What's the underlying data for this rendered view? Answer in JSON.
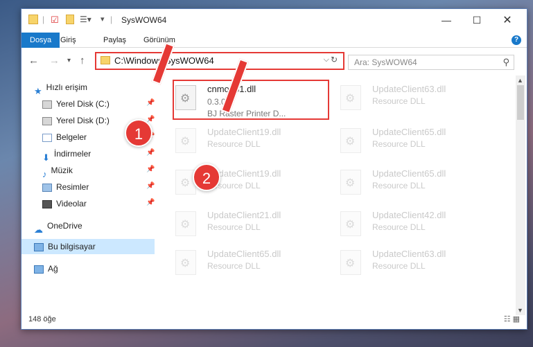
{
  "window": {
    "title": "SysWOW64"
  },
  "ribbon": {
    "tabs": [
      "Dosya",
      "Giriş",
      "Paylaş",
      "Görünüm"
    ]
  },
  "address": {
    "path": "C:\\Windows\\SysWOW64"
  },
  "search": {
    "placeholder": "Ara: SysWOW64"
  },
  "sidebar": {
    "items": [
      {
        "label": "Hızlı erişim"
      },
      {
        "label": "Yerel Disk (C:)"
      },
      {
        "label": "Yerel Disk (D:)"
      },
      {
        "label": "Belgeler"
      },
      {
        "label": "İndirmeler"
      },
      {
        "label": "Müzik"
      },
      {
        "label": "Resimler"
      },
      {
        "label": "Videolar"
      },
      {
        "label": "OneDrive"
      },
      {
        "label": "Bu bilgisayar"
      },
      {
        "label": "Ağ"
      }
    ]
  },
  "files": {
    "main": {
      "name": "cnmop61.dll",
      "version": "0.3.0.0",
      "desc": "BJ Raster Printer D..."
    },
    "faded": [
      {
        "name": "UpdateClient63.dll",
        "sub": "Resource DLL"
      },
      {
        "name": "UpdateClient19.dll",
        "sub": "Resource DLL"
      },
      {
        "name": "UpdateClient65.dll",
        "sub": "Resource DLL"
      },
      {
        "name": "UpdateClient19.dll",
        "sub": "Resource DLL"
      },
      {
        "name": "UpdateClient65.dll",
        "sub": "Resource DLL"
      },
      {
        "name": "UpdateClient21.dll",
        "sub": "Resource DLL"
      },
      {
        "name": "UpdateClient42.dll",
        "sub": "Resource DLL"
      },
      {
        "name": "UpdateClient65.dll",
        "sub": "Resource DLL"
      },
      {
        "name": "UpdateClient63.dll",
        "sub": "Resource DLL"
      }
    ]
  },
  "status": {
    "count": "148 öğe"
  },
  "annotations": {
    "step1": "1",
    "step2": "2"
  },
  "colors": {
    "accent": "#1979ca",
    "highlight": "#e53935"
  }
}
